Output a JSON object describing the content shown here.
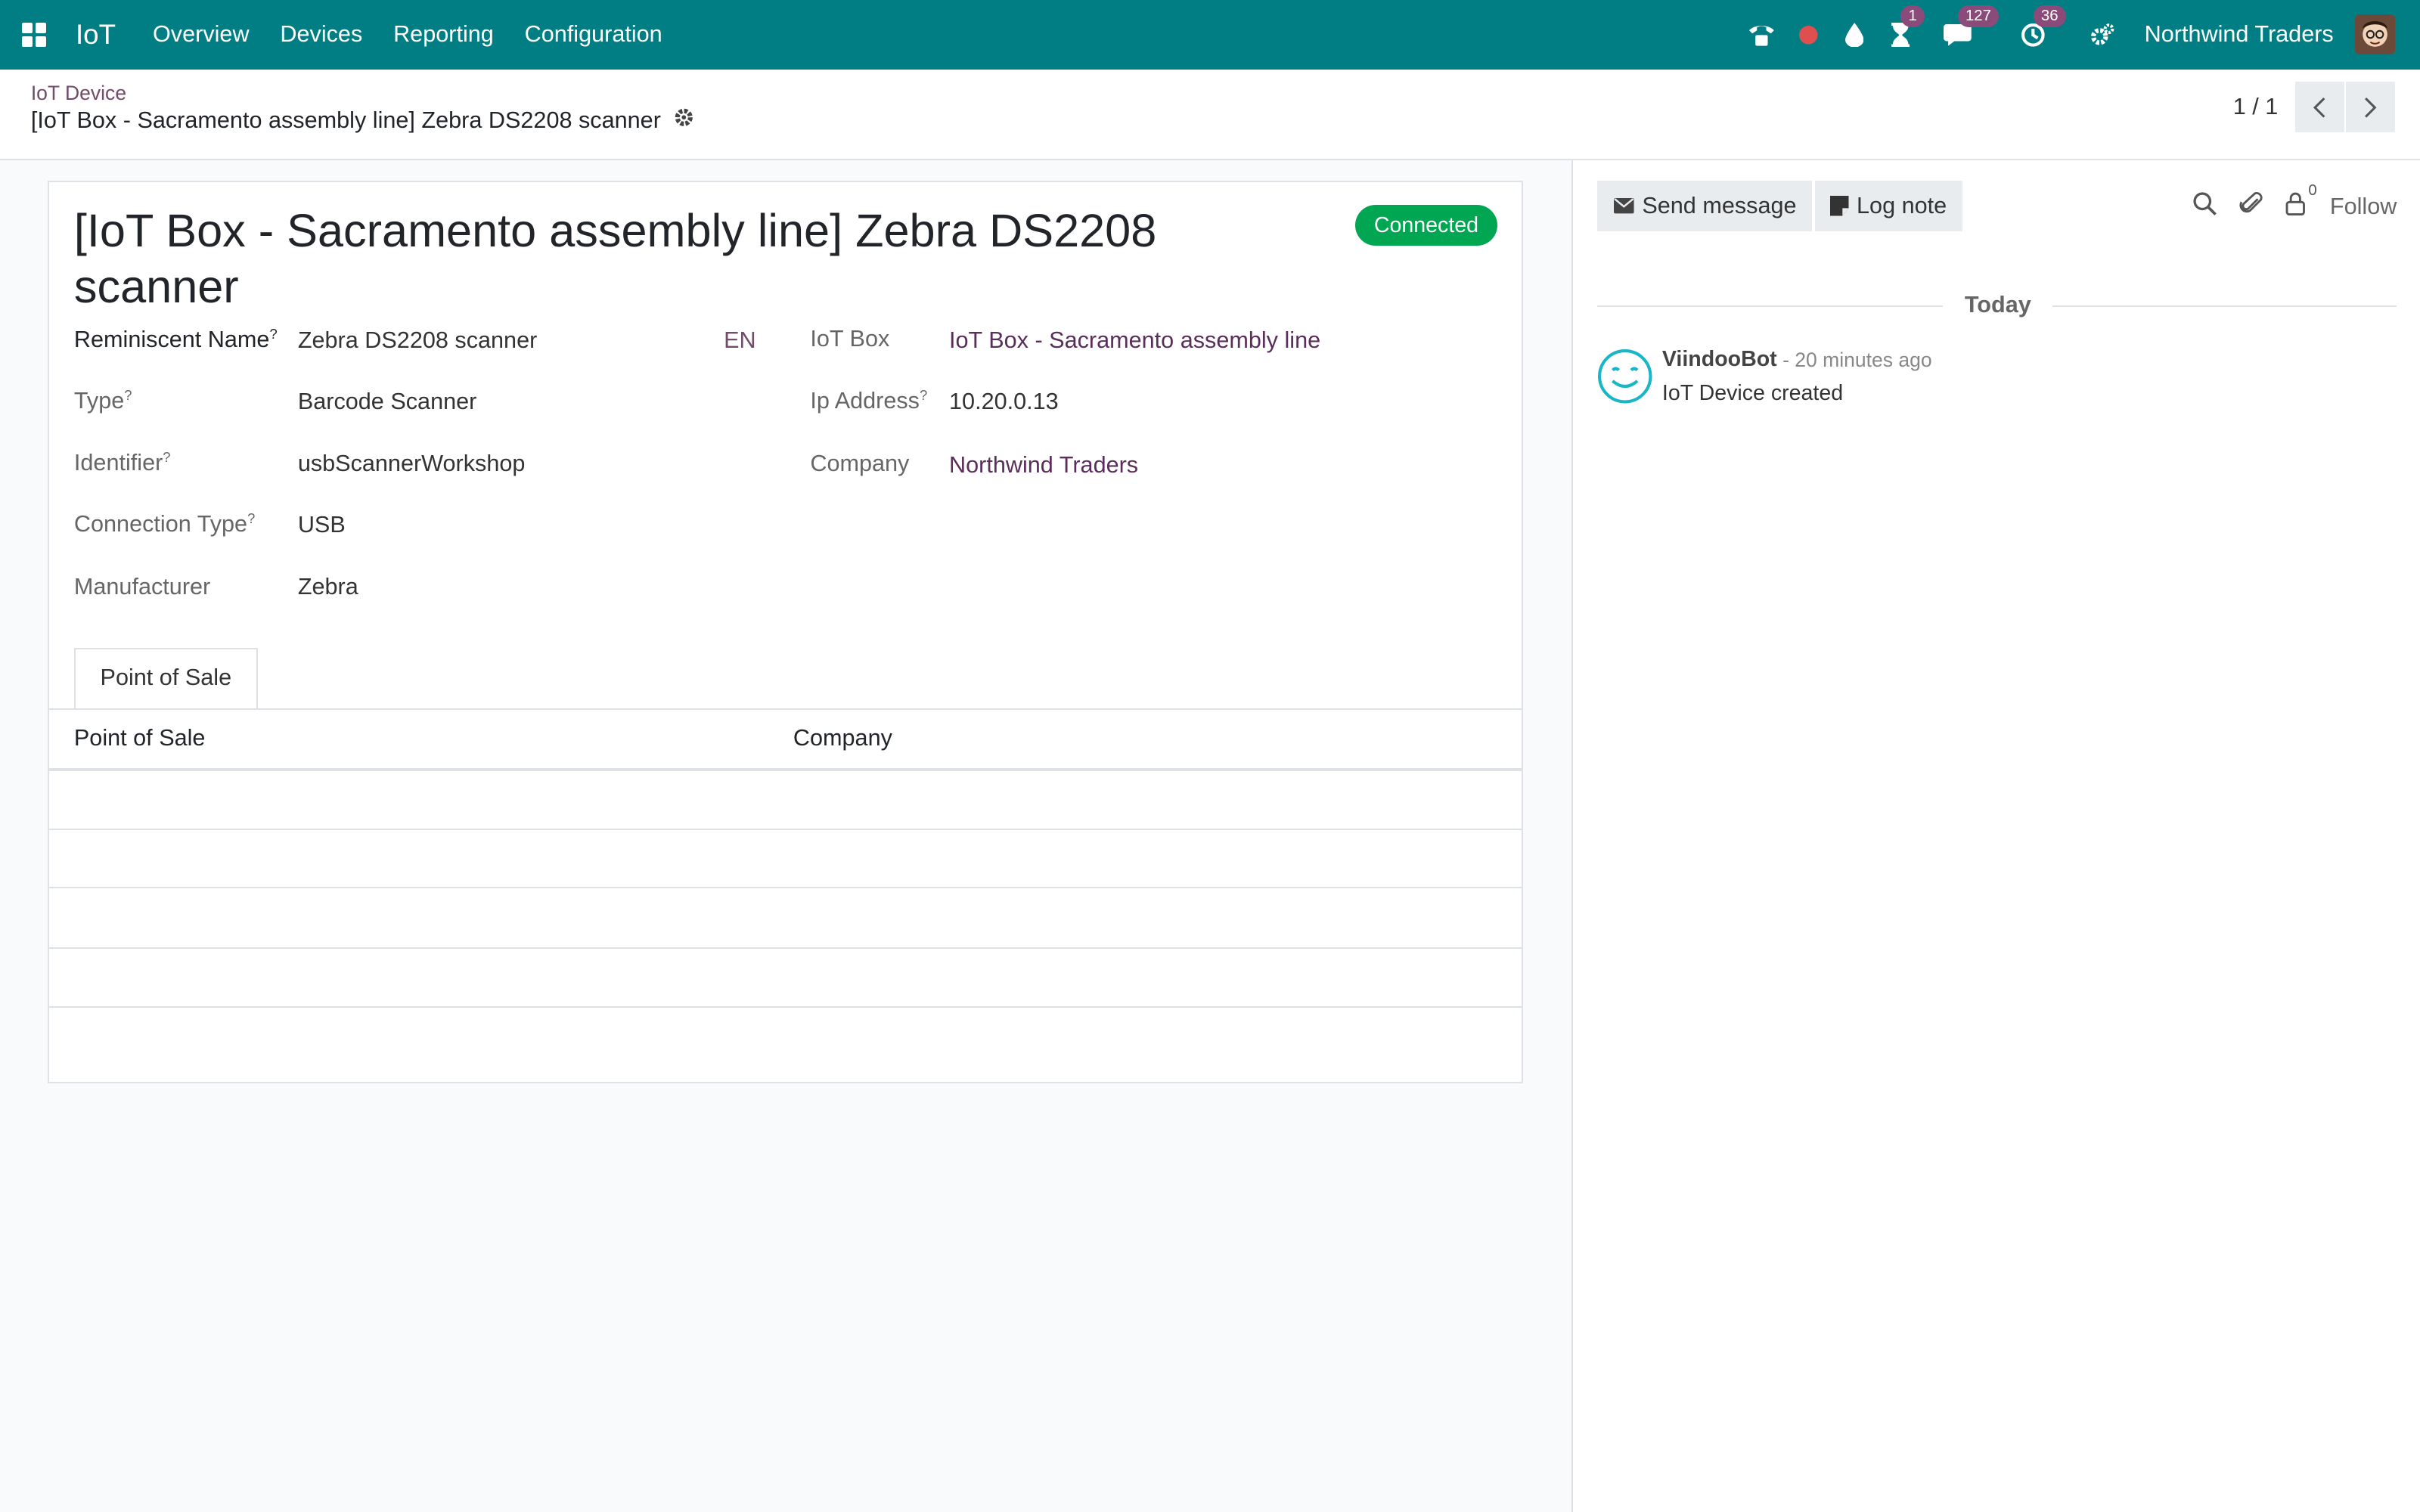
{
  "navbar": {
    "app_name": "IoT",
    "menu": [
      "Overview",
      "Devices",
      "Reporting",
      "Configuration"
    ],
    "badges": {
      "activities": "1",
      "messages": "127",
      "clock": "36"
    },
    "company": "Northwind Traders"
  },
  "breadcrumb": {
    "parent": "IoT Device",
    "current": "[IoT Box - Sacramento assembly line] Zebra DS2208 scanner"
  },
  "pager": {
    "value": "1 / 1"
  },
  "form": {
    "title_line1": "[IoT Box - Sacramento assembly line] Zebra DS2208",
    "title_line2": "scanner",
    "status": "Connected",
    "status_color": "#00a651",
    "fields_left": [
      {
        "label": "Reminiscent Name",
        "value": "Zebra DS2208 scanner"
      },
      {
        "label": "Type",
        "value": "Barcode Scanner"
      },
      {
        "label": "Identifier",
        "value": "usbScannerWorkshop"
      },
      {
        "label": "Connection Type",
        "value": "USB"
      },
      {
        "label": "Manufacturer",
        "value": "Zebra"
      }
    ],
    "lang": "EN",
    "fields_right": [
      {
        "label": "IoT Box",
        "value": "IoT Box - Sacramento assembly line"
      },
      {
        "label": "Ip Address",
        "value": "10.20.0.13"
      },
      {
        "label": "Company",
        "value": "Northwind Traders"
      }
    ],
    "tooltip_mark": "?",
    "tab": "Point of Sale",
    "columns": [
      "Point of Sale",
      "Company"
    ]
  },
  "chatter": {
    "send_message": "Send message",
    "log_note": "Log note",
    "followers_count": "0",
    "follow": "Follow",
    "divider": "Today",
    "message": {
      "author": "ViindooBot",
      "time": "- 20 minutes ago",
      "body": "IoT Device created"
    }
  },
  "colors": {
    "brand": "#017e84",
    "link": "#714b67"
  }
}
